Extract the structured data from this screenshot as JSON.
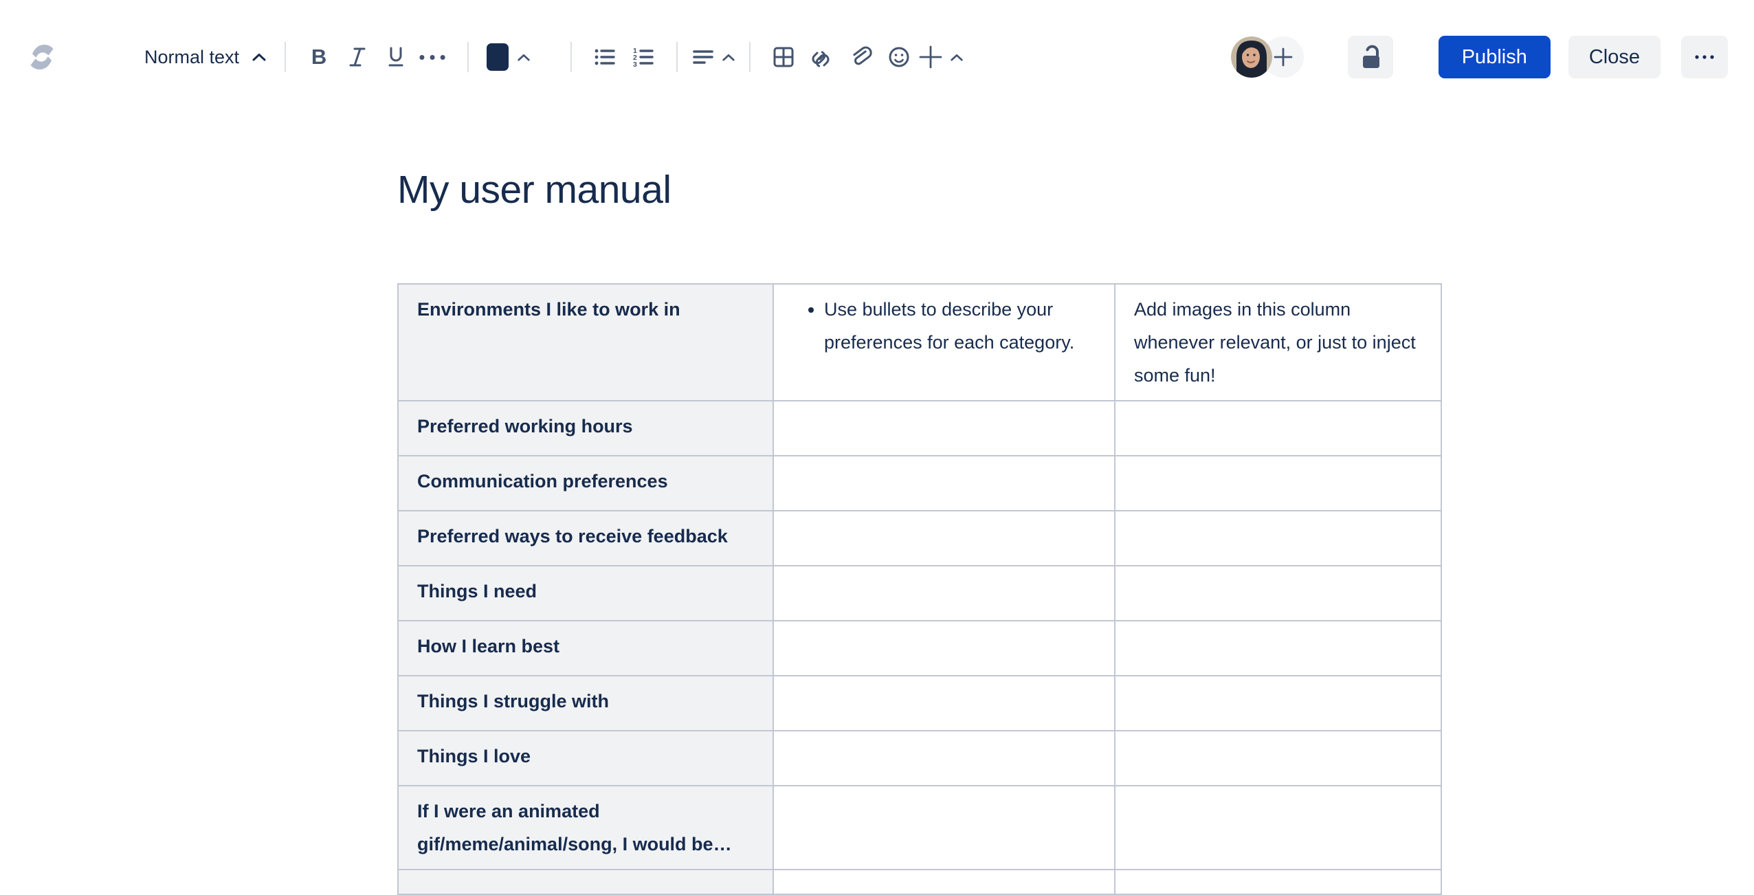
{
  "toolbar": {
    "text_style_label": "Normal text",
    "formatting_icons": [
      "bold-icon",
      "italic-icon",
      "underline-icon",
      "more-formatting-icon"
    ],
    "color_picker_icon": "text-color-swatch",
    "list_icons": [
      "bullet-list-icon",
      "numbered-list-icon"
    ],
    "alignment_icon": "align-left-icon",
    "insert_icons": [
      "table-icon",
      "link-icon",
      "attachment-icon",
      "emoji-icon",
      "plus-icon"
    ],
    "bold_glyph": "B",
    "more_glyph": "•••",
    "publish_label": "Publish",
    "close_label": "Close",
    "restrictions_icon": "unlock-icon",
    "invite_icon": "plus-icon",
    "logo_icon": "confluence-logo"
  },
  "document": {
    "title": "My user manual",
    "table": {
      "rows": [
        {
          "category": "Environments I like to work in",
          "bullet_hint": "Use bullets to describe your\npreferences for each category.",
          "image_hint": "Add images in this column\nwhenever relevant, or just to inject\nsome fun!"
        },
        {
          "category": "Preferred working hours"
        },
        {
          "category": "Communication preferences"
        },
        {
          "category": "Preferred ways to receive feedback"
        },
        {
          "category": "Things I need"
        },
        {
          "category": "How I learn best"
        },
        {
          "category": "Things I struggle with"
        },
        {
          "category": "Things I love"
        },
        {
          "category": "If I were an animated gif/meme/animal/song, I would be…"
        }
      ]
    }
  },
  "colors": {
    "text": "#172B4D",
    "icon": "#44546F",
    "publish_blue": "#0C4BC8",
    "button_bg": "#F1F2F4",
    "header_cell_bg": "#F1F2F4",
    "table_border": "#C1C7D2",
    "logo_gray": "#AFB9C9"
  }
}
